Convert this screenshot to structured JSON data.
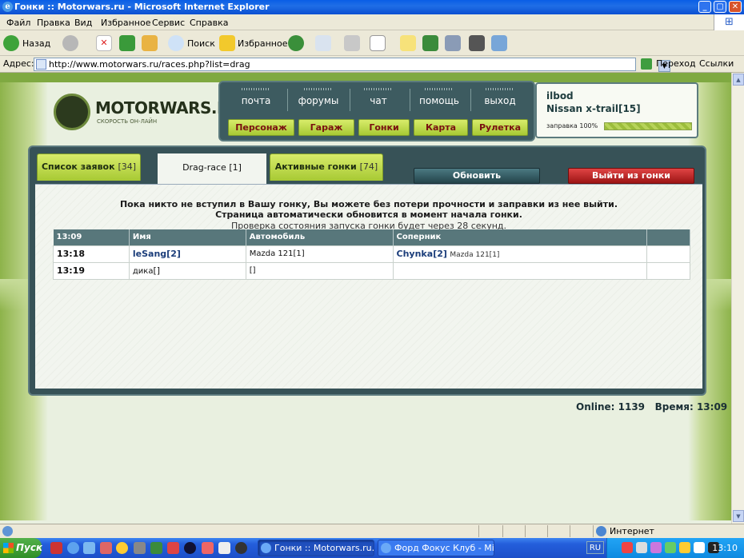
{
  "window": {
    "title": "Гонки :: Motorwars.ru - Microsoft Internet Explorer",
    "min": "_",
    "max": "▢",
    "close": "✕"
  },
  "menu": [
    "Файл",
    "Правка",
    "Вид",
    "Избранное",
    "Сервис",
    "Справка"
  ],
  "toolbar": {
    "back": "Назад",
    "search": "Поиск",
    "favorites": "Избранное"
  },
  "address": {
    "label": "Адрес:",
    "url": "http://www.motorwars.ru/races.php?list=drag",
    "go": "Переход",
    "links": "Ссылки"
  },
  "logo": {
    "text": "MOTORWARS.RU",
    "subtitle": "СКОРОСТЬ ОН-ЛАЙН"
  },
  "nav": {
    "top": [
      "почта",
      "форумы",
      "чат",
      "помощь",
      "выход"
    ],
    "buttons": [
      "Персонаж",
      "Гараж",
      "Гонки",
      "Карта",
      "Рулетка"
    ]
  },
  "user": {
    "name": "ilbod",
    "car": "Nissan x-trail",
    "level": "[15]",
    "fuel_label": "заправка 100%",
    "fuel": 1.0
  },
  "tabs": {
    "requests": {
      "label": "Список заявок",
      "count": "[34]"
    },
    "drag": {
      "label": "Drag-race",
      "count": "[1]"
    },
    "active": {
      "label": "Активные гонки",
      "count": "[74]"
    }
  },
  "actions": {
    "refresh": "Обновить",
    "leave": "Выйти из гонки"
  },
  "message": {
    "line1": "Пока никто не вступил в Вашу гонку, Вы можете без потери прочности и заправки из нее выйти.",
    "line2": "Страница автоматически обновится в момент начала гонки.",
    "line3": "Проверка состояния запуска гонки будет через 28 секунд."
  },
  "table": {
    "headers": [
      "13:09",
      "Имя",
      "Автомобиль",
      "Соперник",
      ""
    ],
    "rows": [
      {
        "time": "13:18",
        "name": "leSang",
        "level": "[2]",
        "car": "Mazda 121[1]",
        "opp_name": "Chynka",
        "opp_level": "[2]",
        "opp_car": "Mazda 121[1]"
      },
      {
        "time": "13:19",
        "name": "дика",
        "level": "[]",
        "car": "[]",
        "opp_name": "",
        "opp_level": "",
        "opp_car": ""
      }
    ]
  },
  "footer": {
    "online": "Online: 1139",
    "time": "Время: 13:09"
  },
  "status": {
    "zone": "Интернет"
  },
  "taskbar": {
    "start": "Пуск",
    "tasks": [
      "Гонки :: Motorwars.ru...",
      "Форд Фокус Клуб - Micr..."
    ],
    "lang": "RU",
    "clock": "13:10"
  }
}
